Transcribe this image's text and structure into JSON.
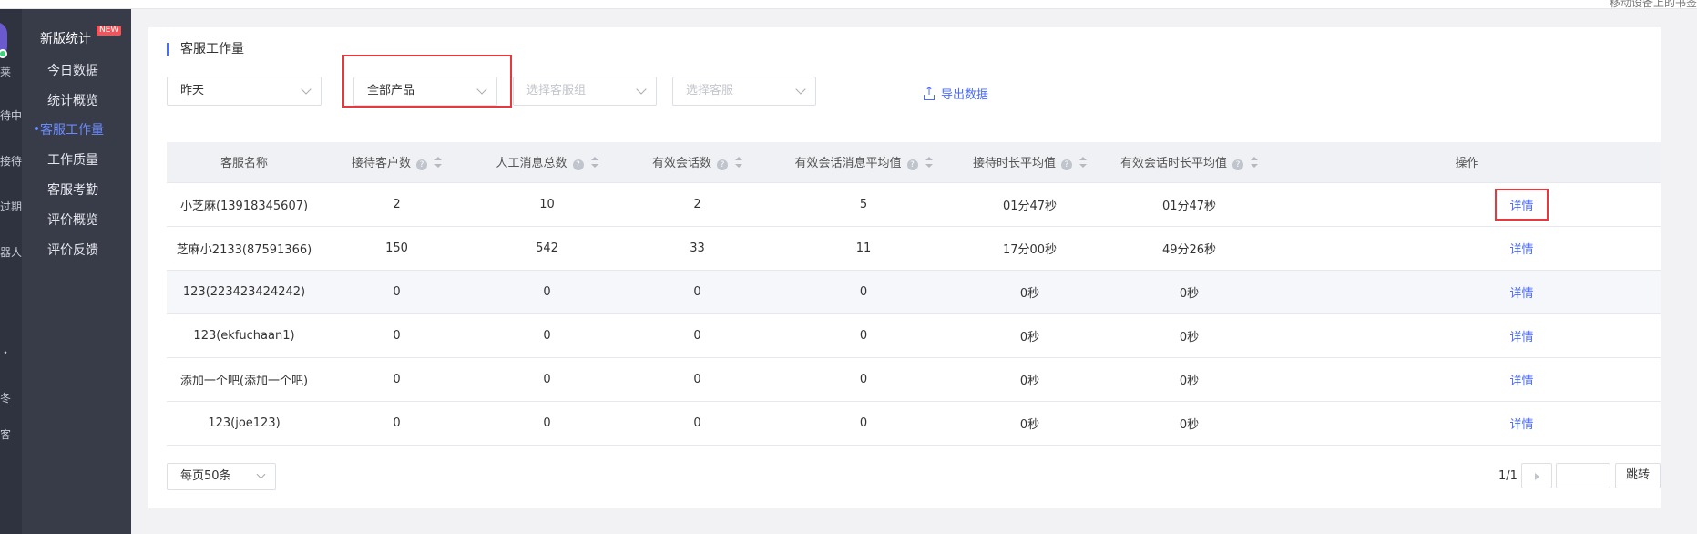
{
  "topbar": {
    "label": "移动设备上的书签"
  },
  "rail": {
    "items": [
      "莱",
      "待中",
      "接待",
      "过期",
      "器人",
      "・",
      "冬",
      "客"
    ]
  },
  "subnav": {
    "title": "新版统计",
    "badge": "NEW",
    "items": [
      "今日数据",
      "统计概览",
      "客服工作量",
      "工作质量",
      "客服考勤",
      "评价概览",
      "评价反馈"
    ],
    "active_index": 2
  },
  "panel": {
    "title": "客服工作量",
    "filters": {
      "date": "昨天",
      "product": "全部产品",
      "group_placeholder": "选择客服组",
      "agent_placeholder": "选择客服"
    },
    "export_label": "导出数据"
  },
  "table": {
    "headers": [
      "客服名称",
      "接待客户数",
      "人工消息总数",
      "有效会话数",
      "有效会话消息平均值",
      "接待时长平均值",
      "有效会话时长平均值",
      "操作"
    ],
    "rows": [
      [
        "小芝麻(13918345607)",
        "2",
        "10",
        "2",
        "5",
        "01分47秒",
        "01分47秒",
        "详情"
      ],
      [
        "芝麻小2133(87591366)",
        "150",
        "542",
        "33",
        "11",
        "17分00秒",
        "49分26秒",
        "详情"
      ],
      [
        "123(223423424242)",
        "0",
        "0",
        "0",
        "0",
        "0秒",
        "0秒",
        "详情"
      ],
      [
        "123(ekfuchaan1)",
        "0",
        "0",
        "0",
        "0",
        "0秒",
        "0秒",
        "详情"
      ],
      [
        "添加一个吧(添加一个吧)",
        "0",
        "0",
        "0",
        "0",
        "0秒",
        "0秒",
        "详情"
      ],
      [
        "123(joe123)",
        "0",
        "0",
        "0",
        "0",
        "0秒",
        "0秒",
        "详情"
      ]
    ]
  },
  "pager": {
    "page_size": "每页50条",
    "page_info": "1/1",
    "jump_label": "跳转"
  },
  "colors": {
    "accent": "#4a6bff",
    "highlight": "#e8383d",
    "sidebar": "#383c49"
  }
}
